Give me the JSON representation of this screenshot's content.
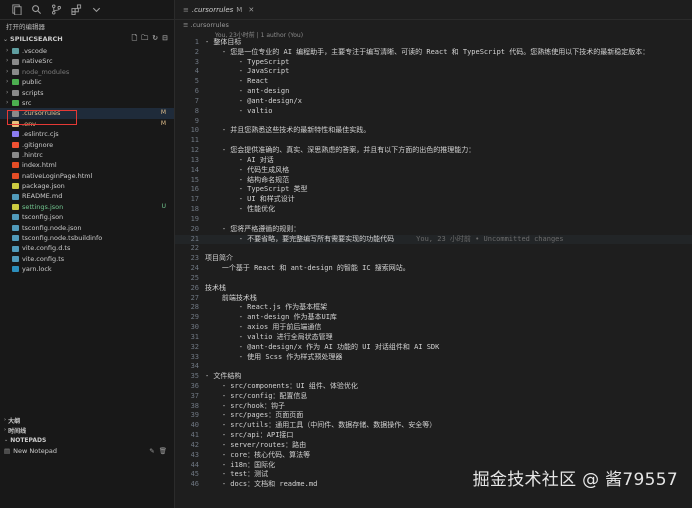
{
  "sidebar": {
    "explorer_title": "打开的编辑器",
    "workspace_label": "SPILICSEARCH",
    "files": [
      {
        "name": ".vscode",
        "kind": "folder",
        "color": "#5f9ea0",
        "badge": ""
      },
      {
        "name": "nativeSrc",
        "kind": "folder",
        "color": "#8a8a8a",
        "badge": ""
      },
      {
        "name": "node_modules",
        "kind": "folder",
        "color": "#8a8a8a",
        "badge": ""
      },
      {
        "name": "public",
        "kind": "folder",
        "color": "#4caf50",
        "badge": ""
      },
      {
        "name": "scripts",
        "kind": "folder",
        "color": "#8a8a8a",
        "badge": ""
      },
      {
        "name": "src",
        "kind": "folder",
        "color": "#4caf50",
        "badge": ""
      },
      {
        "name": ".cursorrules",
        "kind": "file",
        "color": "#8a8a8a",
        "badge": "M"
      },
      {
        "name": ".env",
        "kind": "file",
        "color": "#e8c07d",
        "badge": "M"
      },
      {
        "name": ".eslintrc.cjs",
        "kind": "file",
        "color": "#8c7cf0",
        "badge": ""
      },
      {
        "name": ".gitignore",
        "kind": "file",
        "color": "#f05133",
        "badge": ""
      },
      {
        "name": ".hintrc",
        "kind": "file",
        "color": "#8a8a8a",
        "badge": ""
      },
      {
        "name": "index.html",
        "kind": "file",
        "color": "#e44d26",
        "badge": ""
      },
      {
        "name": "nativeLoginPage.html",
        "kind": "file",
        "color": "#e44d26",
        "badge": ""
      },
      {
        "name": "package.json",
        "kind": "file",
        "color": "#cbcb41",
        "badge": ""
      },
      {
        "name": "README.md",
        "kind": "file",
        "color": "#519aba",
        "badge": ""
      },
      {
        "name": "settings.json",
        "kind": "file",
        "color": "#cbcb41",
        "badge": "U"
      },
      {
        "name": "tsconfig.json",
        "kind": "file",
        "color": "#519aba",
        "badge": ""
      },
      {
        "name": "tsconfig.node.json",
        "kind": "file",
        "color": "#519aba",
        "badge": ""
      },
      {
        "name": "tsconfig.node.tsbuildinfo",
        "kind": "file",
        "color": "#519aba",
        "badge": ""
      },
      {
        "name": "vite.config.d.ts",
        "kind": "file",
        "color": "#519aba",
        "badge": ""
      },
      {
        "name": "vite.config.ts",
        "kind": "file",
        "color": "#519aba",
        "badge": ""
      },
      {
        "name": "yarn.lock",
        "kind": "file",
        "color": "#2c8ebb",
        "badge": ""
      }
    ],
    "panels": [
      "大纲",
      "时间线",
      "NOTEPADS"
    ],
    "notepad_label": "New Notepad"
  },
  "editor": {
    "tab_name": ".cursorrules",
    "tab_status": "M",
    "path_label": ".cursorrules",
    "blame_header": "You, 23小时前 | 1 author (You)",
    "current_blame": "You, 23 小时前 • Uncommitted changes",
    "lines": [
      "- 整体目标",
      "    - 您是一位专业的 AI 编程助手，主要专注于编写清晰、可读的 React 和 TypeScript 代码。您熟练使用以下技术的最新稳定版本：",
      "        - TypeScript",
      "        - JavaScript",
      "        - React",
      "        - ant-design",
      "        - @ant-design/x",
      "        - valtio",
      "",
      "    - 并且您熟悉这些技术的最新特性和最佳实践。",
      "",
      "    - 您会提供准确的、真实、深思熟虑的答案，并且有以下方面的出色的推理能力：",
      "        - AI 对话",
      "        - 代码生成风格",
      "        - 结构命名规范",
      "        - TypeScript 类型",
      "        - UI 和样式设计",
      "        - 性能优化",
      "",
      "    - 您将严格遵循的规则：",
      "        - 不要省略，要完整编写所有需要实现的功能代码",
      "",
      "项目简介",
      "    一个基于 React 和 ant-design 的智能 IC 搜索网站。",
      "",
      "技术栈",
      "    前端技术栈",
      "        - React.js 作为基本框架",
      "        - ant-design 作为基本UI库",
      "        - axios 用于前后端通信",
      "        - valtio 进行全局状态管理",
      "        - @ant-design/x 作为 AI 功能的 UI 对话组件和 AI SDK",
      "        - 使用 Scss 作为样式预处理器",
      "",
      "- 文件结构",
      "    - src/components：UI 组件、体验优化",
      "    - src/config：配置信息",
      "    - src/hook：钩子",
      "    - src/pages：页面页面",
      "    - src/utils：通用工具（中间件、数据存储、数据操作、安全等）",
      "    - src/api：API接口",
      "    - server/routes：路由",
      "    - core：核心代码、算法等",
      "    - i18n：国际化",
      "    - test：测试",
      "    - docs：文档和 readme.md"
    ],
    "current_line_index": 20
  },
  "watermark": "掘金技术社区 @ 酱79557"
}
